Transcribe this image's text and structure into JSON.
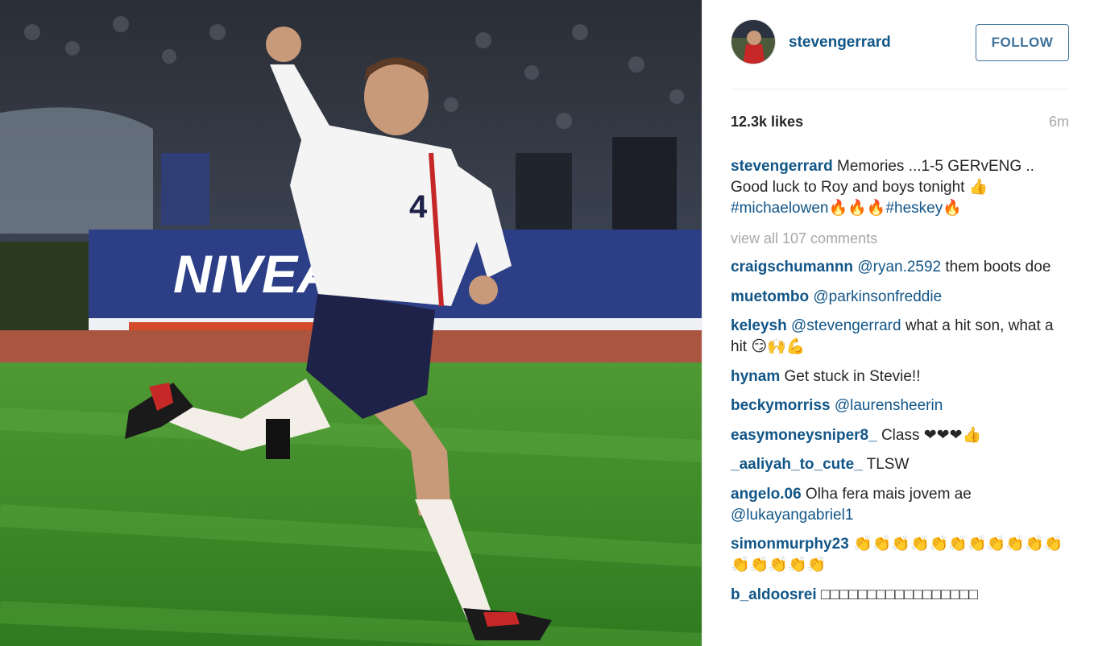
{
  "post": {
    "username": "stevengerrard",
    "follow_label": "FOLLOW",
    "likes": "12.3k likes",
    "time": "6m"
  },
  "caption": {
    "user": "stevengerrard",
    "text_1": " Memories ...1-5 GERvENG .. Good luck to Roy and boys tonight 👍 ",
    "tag_1": "#michaelowen",
    "emoji_1": "🔥🔥🔥",
    "tag_2": "#heskey",
    "emoji_2": "🔥"
  },
  "view_all_label": "view all 107 comments",
  "comments": [
    {
      "user": "craigschumannn",
      "mention": "@ryan.2592",
      "text": " them boots doe"
    },
    {
      "user": "muetombo",
      "mention": "@parkinsonfreddie",
      "text": ""
    },
    {
      "user": "keleysh",
      "mention": "@stevengerrard",
      "text": " what a hit son, what a hit 😏🙌💪"
    },
    {
      "user": "hynam",
      "mention": "",
      "text": " Get stuck in Stevie!!"
    },
    {
      "user": "beckymorriss",
      "mention": "@laurensheerin",
      "text": ""
    },
    {
      "user": "easymoneysniper8_",
      "mention": "",
      "text": " Class ❤❤❤👍"
    },
    {
      "user": "_aaliyah_to_cute_",
      "mention": "",
      "text": " TLSW"
    },
    {
      "user": "angelo.06",
      "mention": "",
      "text": " Olha fera mais jovem ae"
    },
    {
      "user": "",
      "mention": "@lukayangabriel1",
      "text": ""
    },
    {
      "user": "simonmurphy23",
      "mention": "",
      "text": " 👏👏👏👏👏👏👏👏👏👏👏👏👏👏👏👏"
    },
    {
      "user": "b_aldoosrei",
      "mention": "",
      "text": " □□□□□□□□□□□□□□□□□"
    }
  ],
  "photo": {
    "board_text": "NIVEA",
    "shirt_number": "4"
  },
  "colors": {
    "link_blue": "#125688",
    "follow_blue": "#3f729b",
    "muted_gray": "#a5a7aa",
    "pitch_green": "#3f8a2a"
  }
}
